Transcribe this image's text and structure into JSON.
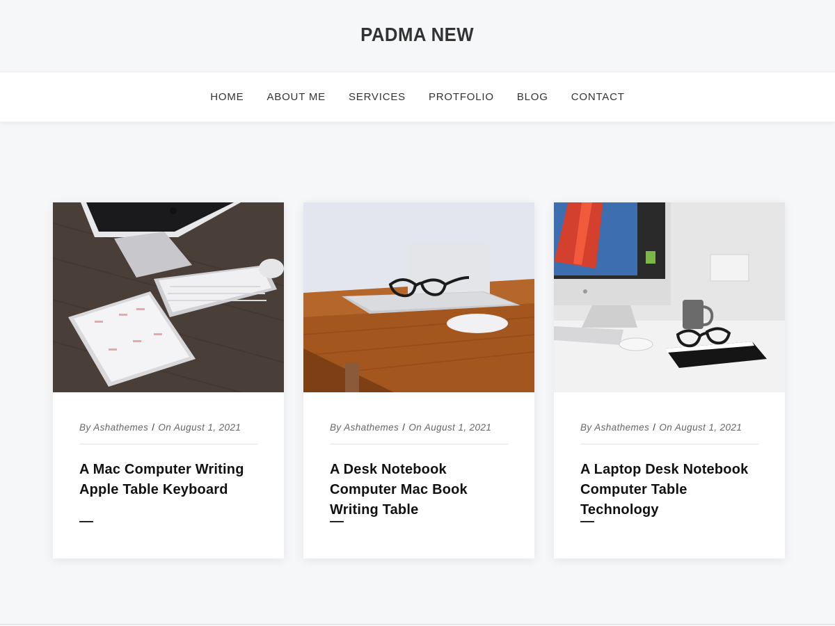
{
  "site": {
    "title": "PADMA NEW"
  },
  "nav": {
    "items": [
      {
        "label": "HOME"
      },
      {
        "label": "ABOUT ME"
      },
      {
        "label": "SERVICES"
      },
      {
        "label": "PROTFOLIO"
      },
      {
        "label": "BLOG"
      },
      {
        "label": "CONTACT"
      }
    ]
  },
  "posts": [
    {
      "author": "By Ashathemes",
      "date": "On August 1, 2021",
      "title": "A Mac Computer Writing Apple Table Keyboard",
      "image": "imac-keyboard-tablet-on-dark-wood-desk"
    },
    {
      "author": "By Ashathemes",
      "date": "On August 1, 2021",
      "title": "A Desk Notebook Computer Mac Book Writing Table",
      "image": "laptop-glasses-mouse-on-wooden-table"
    },
    {
      "author": "By Ashathemes",
      "date": "On August 1, 2021",
      "title": "A Laptop Desk Notebook Computer Table Technology",
      "image": "imac-mug-notebook-glasses-on-white-desk"
    }
  ],
  "colors": {
    "background": "#f6f7f9",
    "nav_background": "#ffffff",
    "text": "#222222",
    "meta": "#666666"
  }
}
